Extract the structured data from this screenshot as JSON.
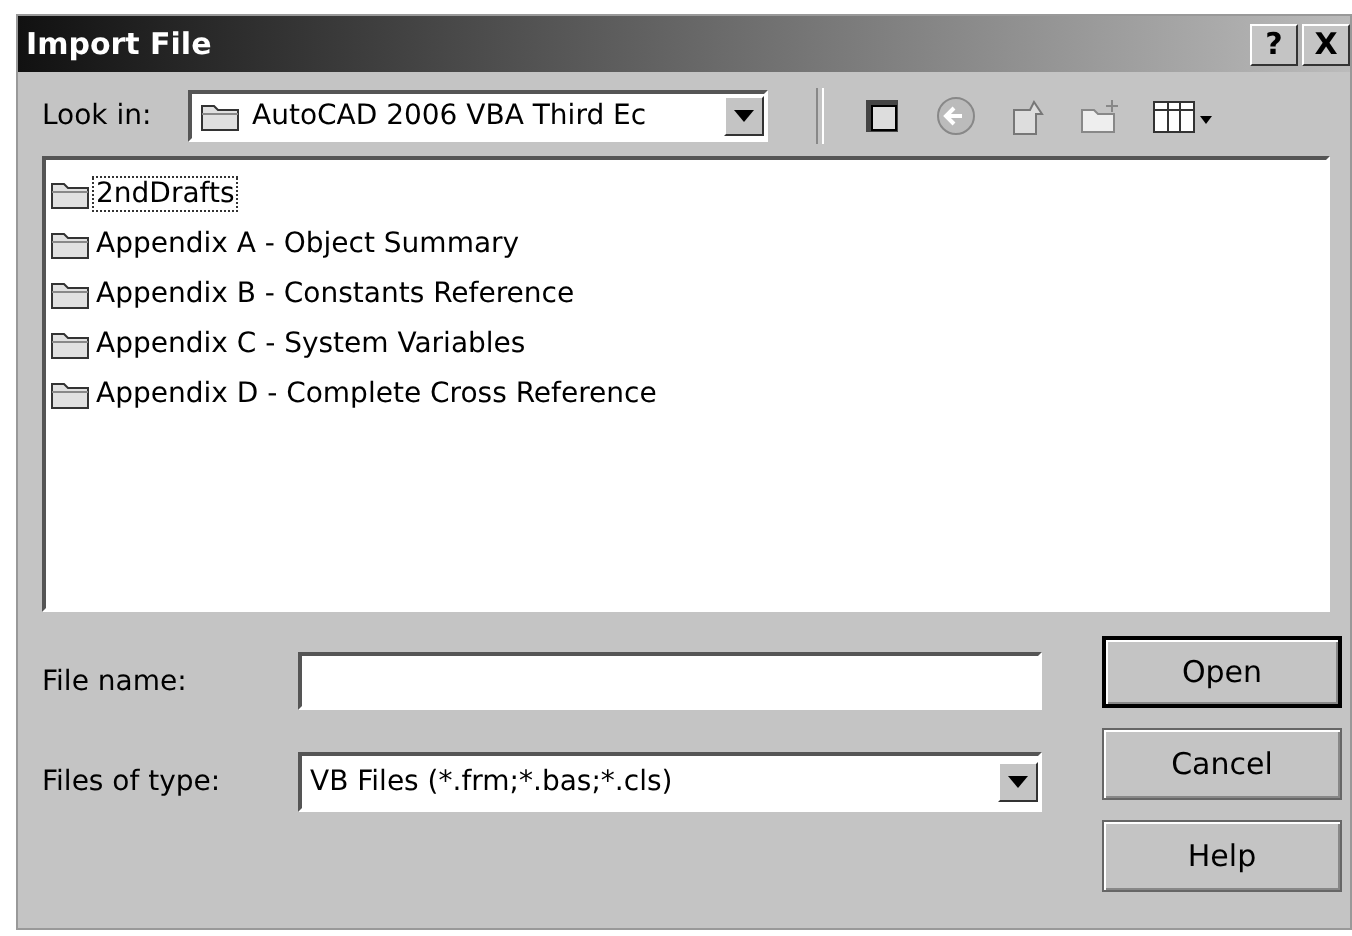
{
  "window": {
    "title": "Import File",
    "title_buttons": [
      "?",
      "X"
    ]
  },
  "look_in": {
    "label": "Look in:",
    "value": "AutoCAD 2006 VBA Third Ec"
  },
  "files": [
    {
      "name": "2ndDrafts",
      "focused": true
    },
    {
      "name": "Appendix A - Object Summary",
      "focused": false
    },
    {
      "name": "Appendix B - Constants Reference",
      "focused": false
    },
    {
      "name": "Appendix C - System Variables",
      "focused": false
    },
    {
      "name": "Appendix D - Complete Cross Reference",
      "focused": false
    }
  ],
  "file_name": {
    "label": "File name:"
  },
  "file_type": {
    "label": "Files of type:",
    "value": "VB Files (*.frm;*.bas;*.cls)"
  },
  "buttons": [
    {
      "label": "Open",
      "default": true
    },
    {
      "label": "Cancel",
      "default": false
    },
    {
      "label": "Help",
      "default": false
    }
  ]
}
